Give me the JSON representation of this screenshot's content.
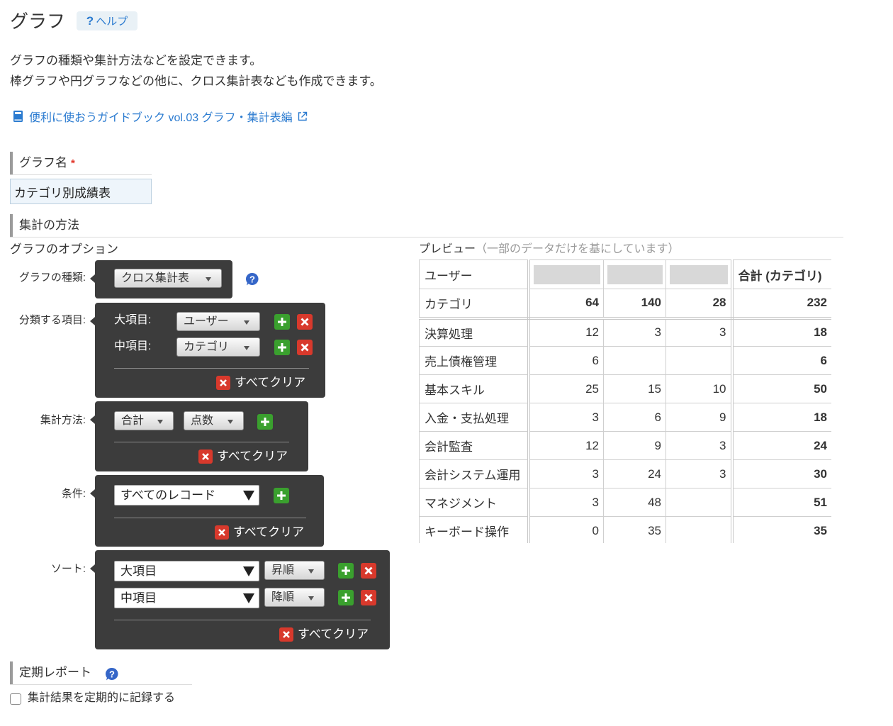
{
  "page": {
    "title": "グラフ"
  },
  "help_button": {
    "mark": "?",
    "label": "ヘルプ"
  },
  "description": {
    "line1": "グラフの種類や集計方法などを設定できます。",
    "line2": "棒グラフや円グラフなどの他に、クロス集計表なども作成できます。"
  },
  "guide_link": {
    "text": "便利に使おうガイドブック vol.03 グラフ・集計表編",
    "icon": "book-icon",
    "trailing_icon": "external-link-icon"
  },
  "graph_name": {
    "label": "グラフ名",
    "required_mark": "*",
    "value": "カテゴリ別成績表"
  },
  "aggregation": {
    "label": "集計の方法"
  },
  "options": {
    "heading": "グラフのオプション",
    "graph_type": {
      "label": "グラフの種類:",
      "value": "クロス集計表"
    },
    "group_by": {
      "label": "分類する項目:",
      "major_label": "大項目:",
      "major_value": "ユーザー",
      "minor_label": "中項目:",
      "minor_value": "カテゴリ",
      "clear_label": "すべてクリア"
    },
    "aggregate": {
      "label": "集計方法:",
      "function": "合計",
      "field": "点数",
      "clear_label": "すべてクリア"
    },
    "condition": {
      "label": "条件:",
      "value": "すべてのレコード",
      "clear_label": "すべてクリア"
    },
    "sort": {
      "label": "ソート:",
      "rows": [
        {
          "field": "大項目",
          "order": "昇順"
        },
        {
          "field": "中項目",
          "order": "降順"
        }
      ],
      "clear_label": "すべてクリア"
    }
  },
  "preview": {
    "heading": "プレビュー",
    "note": "（一部のデータだけを基にしています）",
    "header": {
      "row_label": "ユーザー",
      "total_label": "合計 (カテゴリ)"
    },
    "category_row": {
      "label": "カテゴリ",
      "values": [
        "64",
        "140",
        "28"
      ],
      "total": "232"
    },
    "rows": [
      {
        "label": "決算処理",
        "values": [
          "12",
          "3",
          "3"
        ],
        "total": "18"
      },
      {
        "label": "売上債権管理",
        "values": [
          "6",
          "",
          ""
        ],
        "total": "6"
      },
      {
        "label": "基本スキル",
        "values": [
          "25",
          "15",
          "10"
        ],
        "total": "50"
      },
      {
        "label": "入金・支払処理",
        "values": [
          "3",
          "6",
          "9"
        ],
        "total": "18"
      },
      {
        "label": "会計監査",
        "values": [
          "12",
          "9",
          "3"
        ],
        "total": "24"
      },
      {
        "label": "会計システム運用",
        "values": [
          "3",
          "24",
          "3"
        ],
        "total": "30"
      },
      {
        "label": "マネジメント",
        "values": [
          "3",
          "48",
          ""
        ],
        "total": "51"
      },
      {
        "label": "キーボード操作",
        "values": [
          "0",
          "35",
          ""
        ],
        "total": "35"
      }
    ]
  },
  "periodic_report": {
    "label": "定期レポート",
    "checkbox_label": "集計結果を定期的に記録する",
    "checked": false
  },
  "colors": {
    "link": "#2b7bd0",
    "panel": "#3c3c3c",
    "add": "#3aa02e",
    "remove": "#d8392c",
    "required": "#e2372b",
    "help": "#3566c8"
  }
}
